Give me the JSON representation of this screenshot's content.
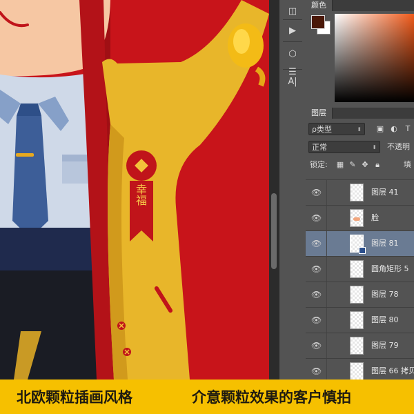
{
  "color_panel": {
    "tab_label": "颜色",
    "foreground_color": "#4a1808",
    "background_color": "#ffffff"
  },
  "layers_panel": {
    "tab_label": "图层",
    "filter_kind": "ρ类型",
    "blend_mode": "正常",
    "opacity_label": "不透明",
    "lock_label": "锁定:",
    "fill_label": "填",
    "layers": [
      {
        "name": "图层 41",
        "selected": false,
        "thumb": "blank"
      },
      {
        "name": "脸",
        "selected": false,
        "thumb": "face"
      },
      {
        "name": "图层 81",
        "selected": true,
        "thumb": "linked"
      },
      {
        "name": "圆角矩形 5",
        "selected": false,
        "thumb": "blank"
      },
      {
        "name": "图层 78",
        "selected": false,
        "thumb": "blank"
      },
      {
        "name": "图层 80",
        "selected": false,
        "thumb": "blank"
      },
      {
        "name": "图层 79",
        "selected": false,
        "thumb": "blank"
      },
      {
        "name": "图层 66 拷贝",
        "selected": false,
        "thumb": "blank"
      }
    ]
  },
  "tools": {
    "type_tool_label": "A|"
  },
  "illustration": {
    "badge_text": "幸福"
  },
  "caption": {
    "left": "北欧颗粒插画风格",
    "right": "介意颗粒效果的客户慎拍"
  },
  "colors": {
    "canvas_red": "#c8141a",
    "coat_yellow": "#e8b62a",
    "caption_yellow": "#f6c000",
    "selected_layer": "#6a7b93"
  }
}
